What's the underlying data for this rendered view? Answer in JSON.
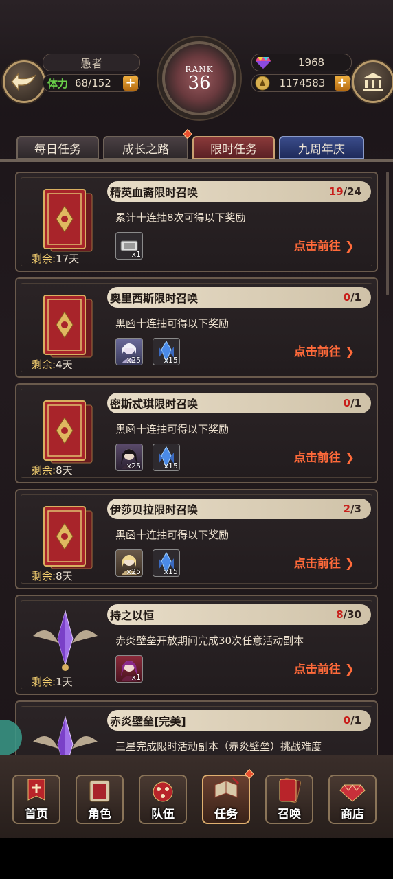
{
  "header": {
    "player_name": "愚者",
    "stamina_label": "体力",
    "stamina_value": "68/152",
    "rank_label": "RANK",
    "rank_value": "36",
    "gems": "1968",
    "gold": "1174583",
    "plus_symbol": "+",
    "back_icon": "back-arrow-icon",
    "library_icon": "library-icon"
  },
  "tabs": [
    {
      "label": "每日任务",
      "active": false
    },
    {
      "label": "成长之路",
      "active": false
    },
    {
      "label": "限时任务",
      "active": true
    },
    {
      "label": "九周年庆",
      "active": false
    }
  ],
  "tasks": [
    {
      "title": "精英血裔限时召唤",
      "current": "19",
      "total": "/24",
      "desc": "累计十连抽8次可得以下奖励",
      "goto": "点击前往 ❯",
      "remain_label": "剩余:",
      "remain_value": "17天",
      "rewards": [
        {
          "icon": "ticket-icon",
          "qty": "x1"
        }
      ],
      "art": "card-book"
    },
    {
      "title": "奥里西斯限时召唤",
      "current": "0",
      "total": "/1",
      "desc": "黑函十连抽可得以下奖励",
      "goto": "点击前往 ❯",
      "remain_label": "剩余:",
      "remain_value": "4天",
      "rewards": [
        {
          "icon": "character-portrait-icon",
          "qty": "x25"
        },
        {
          "icon": "blue-crystal-icon",
          "qty": "x15"
        }
      ],
      "art": "card-book"
    },
    {
      "title": "密斯忒琪限时召唤",
      "current": "0",
      "total": "/1",
      "desc": "黑函十连抽可得以下奖励",
      "goto": "点击前往 ❯",
      "remain_label": "剩余:",
      "remain_value": "8天",
      "rewards": [
        {
          "icon": "character-portrait-icon",
          "qty": "x25"
        },
        {
          "icon": "blue-crystal-icon",
          "qty": "x15"
        }
      ],
      "art": "card-book"
    },
    {
      "title": "伊莎贝拉限时召唤",
      "current": "2",
      "total": "/3",
      "desc": "黑函十连抽可得以下奖励",
      "goto": "点击前往 ❯",
      "remain_label": "剩余:",
      "remain_value": "8天",
      "rewards": [
        {
          "icon": "character-portrait-icon",
          "qty": "x25"
        },
        {
          "icon": "blue-crystal-icon",
          "qty": "x15"
        }
      ],
      "art": "card-book"
    },
    {
      "title": "持之以恒",
      "current": "8",
      "total": "/30",
      "desc": "赤炎壁垒开放期间完成30次任意活动副本",
      "goto": "点击前往 ❯",
      "remain_label": "剩余:",
      "remain_value": "1天",
      "rewards": [
        {
          "icon": "character-portrait-icon",
          "qty": "x1"
        }
      ],
      "art": "crystal-emblem"
    },
    {
      "title": "赤炎壁垒[完美]",
      "current": "0",
      "total": "/1",
      "desc": "三星完成限时活动副本（赤炎壁垒）挑战难度",
      "goto": "",
      "remain_label": "",
      "remain_value": "",
      "rewards": [],
      "art": "crystal-emblem"
    }
  ],
  "nav": [
    {
      "label": "首页",
      "icon": "home-banner-icon"
    },
    {
      "label": "角色",
      "icon": "character-book-icon"
    },
    {
      "label": "队伍",
      "icon": "team-crown-icon"
    },
    {
      "label": "任务",
      "icon": "quest-book-icon"
    },
    {
      "label": "召唤",
      "icon": "summon-card-icon"
    },
    {
      "label": "商店",
      "icon": "shop-gem-icon"
    }
  ],
  "colors": {
    "accent_red": "#c8201c",
    "goto_orange": "#ff6a3a",
    "gold": "#f5d070"
  }
}
